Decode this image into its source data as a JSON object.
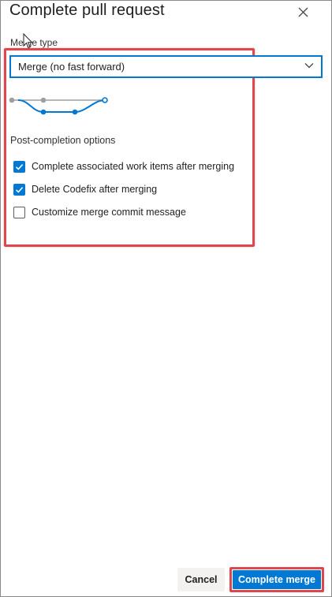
{
  "dialog": {
    "title": "Complete pull request",
    "close_icon": "close-icon"
  },
  "merge_type": {
    "label": "Merge type",
    "selected": "Merge (no fast forward)",
    "dropdown_icon": "chevron-down-icon"
  },
  "post_completion": {
    "title": "Post-completion options",
    "options": [
      {
        "label": "Complete associated work items after merging",
        "checked": true
      },
      {
        "label": "Delete Codefix after merging",
        "checked": true
      },
      {
        "label": "Customize merge commit message",
        "checked": false
      }
    ]
  },
  "footer": {
    "cancel_label": "Cancel",
    "complete_label": "Complete merge"
  },
  "colors": {
    "accent": "#0078d4",
    "highlight": "#e0474c",
    "diagram_gray": "#a19f9d"
  }
}
